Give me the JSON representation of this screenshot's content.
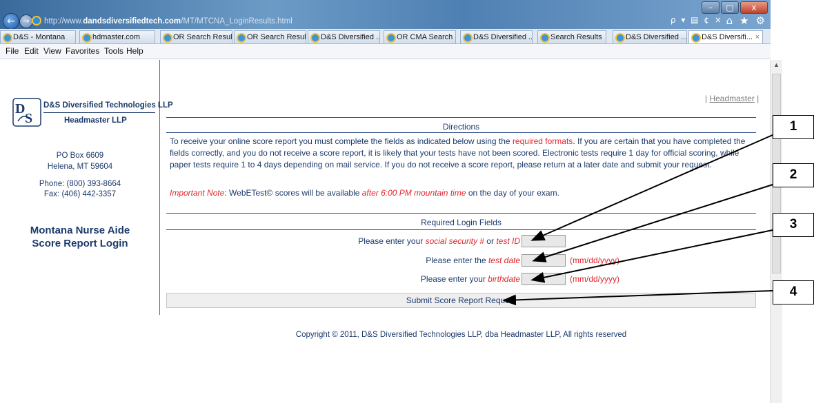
{
  "browser": {
    "url_prefix": "http://www.",
    "url_host": "dandsdiversifiedtech.com",
    "url_path": "/MT/MTCNA_LoginResults.html",
    "addr_tools": "ρ ▾ ▤ ¢ ×",
    "icons": [
      "back-icon",
      "forward-icon",
      "home-icon",
      "favorites-star-icon",
      "gear-icon"
    ],
    "window_controls": [
      "–",
      "▢",
      "x"
    ],
    "tabs": [
      {
        "label": "D&S - Montana"
      },
      {
        "label": "hdmaster.com"
      },
      {
        "label": "OR Search Results"
      },
      {
        "label": "OR Search Results"
      },
      {
        "label": "D&S Diversified ..."
      },
      {
        "label": "OR CMA Search ..."
      },
      {
        "label": "D&S Diversified ..."
      },
      {
        "label": "Search Results"
      },
      {
        "label": "D&S Diversified ..."
      },
      {
        "label": "D&S Diversifi..."
      }
    ],
    "tab_close": "×",
    "menu": [
      "File",
      "Edit",
      "View",
      "Favorites",
      "Tools",
      "Help"
    ]
  },
  "sidebar": {
    "company": "D&S Diversified Technologies LLP",
    "subcompany": "Headmaster LLP",
    "po_box": "PO Box 6609",
    "city": "Helena, MT 59604",
    "phone": "Phone: (800) 393-8664",
    "fax": "Fax: (406) 442-3357",
    "login_title_1": "Montana Nurse Aide",
    "login_title_2": "Score Report Login"
  },
  "header_link": {
    "pre": "| ",
    "label": "Headmaster",
    "post": " |"
  },
  "directions": {
    "title": "Directions",
    "p1_a": "To receive your online score report you must complete the fields as indicated below using the ",
    "p1_red": "required formats",
    "p1_b": ". If you are certain that you have completed the fields correctly, and you do not receive a score report, it is likely that your tests have not been scored. Electronic tests require 1 day for official scoring, while paper tests require 1 to 4 days depending on mail service. If you do not receive a score report, please return at a later date and submit your request.",
    "note_label": "Important Note",
    "note_a": ": WebETest© scores will be available ",
    "note_red": "after 6:00 PM mountain time",
    "note_b": " on the day of your exam."
  },
  "login": {
    "title": "Required Login Fields",
    "f1_pre": "Please enter your ",
    "f1_red1": "social security #",
    "f1_mid": " or ",
    "f1_red2": "test ID",
    "f2_pre": "Please enter the ",
    "f2_red": "test date",
    "f3_pre": "Please enter your ",
    "f3_red": "birthdate",
    "date_format": "(mm/dd/yyyy)",
    "submit": "Submit Score Report Request"
  },
  "copyright": "Copyright © 2011, D&S Diversified Technologies LLP, dba Headmaster LLP, All rights reserved",
  "annotations": [
    "1",
    "2",
    "3",
    "4"
  ],
  "scrollbar": {
    "up_arrow": "▲"
  }
}
